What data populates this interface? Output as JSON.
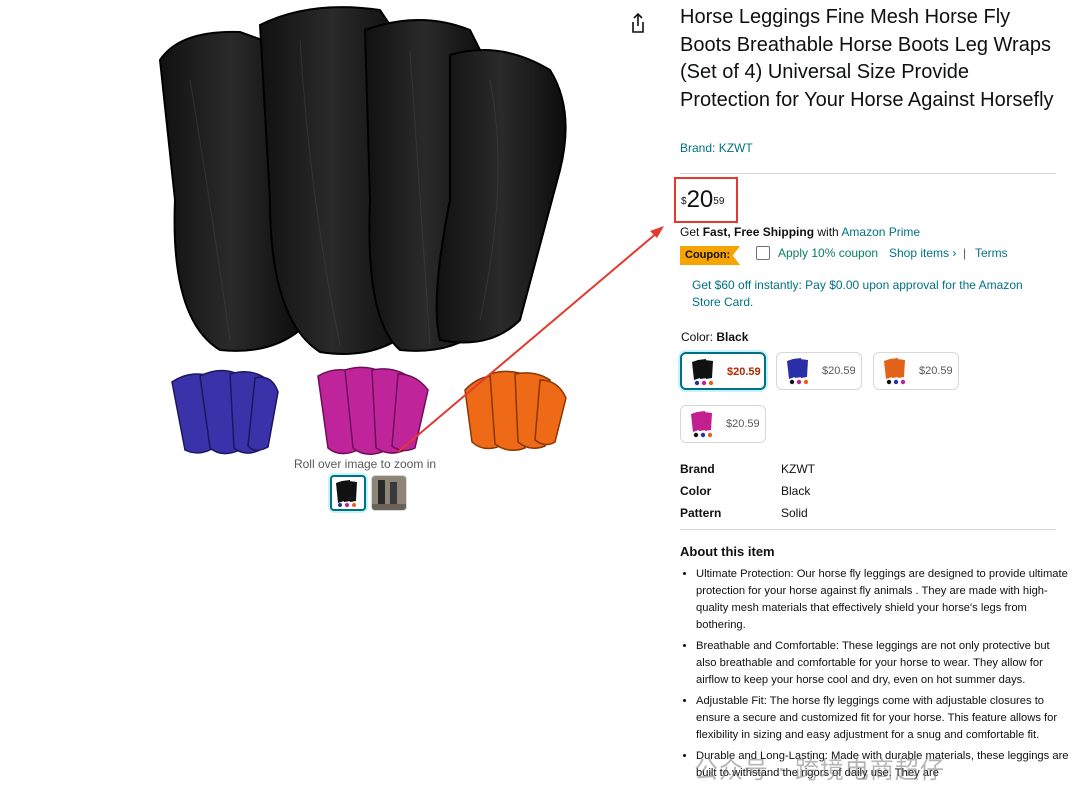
{
  "product": {
    "title": "Horse Leggings Fine Mesh Horse Fly Boots Breathable Horse Boots Leg Wraps (Set of 4) Universal Size Provide Protection for Your Horse Against Horsefly",
    "brand_link": "Brand: KZWT"
  },
  "gallery": {
    "zoom_hint": "Roll over image to zoom in"
  },
  "price": {
    "currency": "$",
    "whole": "20",
    "fraction": "59"
  },
  "shipping": {
    "prefix": "Get ",
    "bold": "Fast, Free Shipping",
    "mid": " with ",
    "link": "Amazon Prime"
  },
  "coupon": {
    "badge": "Coupon:",
    "text": "Apply 10% coupon",
    "shop_link": "Shop items ›",
    "separator": "|",
    "terms": "Terms"
  },
  "store_card": "Get $60 off instantly: Pay $0.00 upon approval for the Amazon Store Card.",
  "color": {
    "label": "Color: ",
    "selected": "Black",
    "options": [
      {
        "name": "Black",
        "price": "$20.59"
      },
      {
        "name": "Blue",
        "price": "$20.59"
      },
      {
        "name": "Orange",
        "price": "$20.59"
      },
      {
        "name": "Pink",
        "price": "$20.59"
      }
    ]
  },
  "specs": [
    {
      "key": "Brand",
      "value": "KZWT"
    },
    {
      "key": "Color",
      "value": "Black"
    },
    {
      "key": "Pattern",
      "value": "Solid"
    }
  ],
  "about": {
    "heading": "About this item",
    "bullets": [
      "Ultimate Protection: Our horse fly leggings are designed to provide ultimate protection for your horse against fly animals . They are made with high-quality mesh materials that effectively shield your horse's legs from bothering.",
      "Breathable and Comfortable: These leggings are not only protective but also breathable and comfortable for your horse to wear. They allow for airflow to keep your horse cool and dry, even on hot summer days.",
      "Adjustable Fit: The horse fly leggings come with adjustable closures to ensure a secure and customized fit for your horse. This feature allows for flexibility in sizing and easy adjustment for a snug and comfortable fit.",
      "Durable and Long-Lasting: Made with durable materials, these leggings are built to withstand the rigors of daily use. They are"
    ]
  },
  "watermark": "公众号 · 跨境电商超仔",
  "colors": {
    "link": "#007185",
    "highlight": "#e23a2e",
    "coupon_green": "#067d62",
    "coupon_badge": "#f7a300"
  },
  "icons": [
    "share-icon",
    "checkbox-icon"
  ]
}
